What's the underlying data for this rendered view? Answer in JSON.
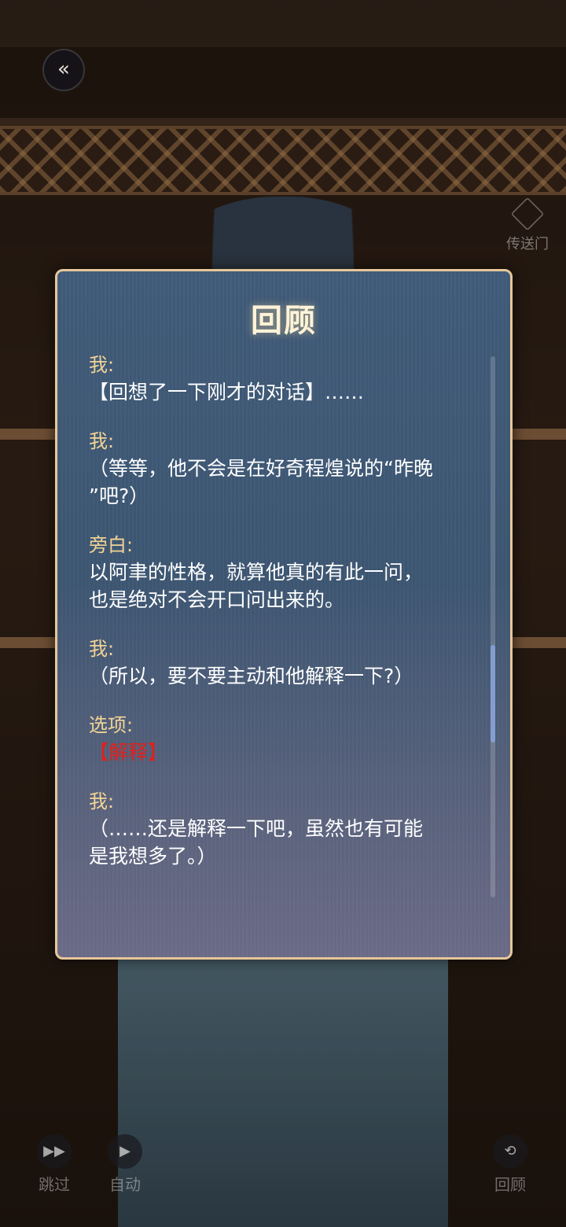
{
  "hud": {
    "teleport_label": "传送门",
    "skip_label": "跳过",
    "auto_label": "自动",
    "review_label": "回顾"
  },
  "review": {
    "title": "回顾",
    "entries": [
      {
        "speaker": "我:",
        "text": "【回想了一下刚才的对话】……"
      },
      {
        "speaker": "我:",
        "text": "（等等，他不会是在好奇程煌说的“昨晚\n”吧?）"
      },
      {
        "speaker": "旁白:",
        "text": "以阿聿的性格，就算他真的有此一问，\n也是绝对不会开口问出来的。"
      },
      {
        "speaker": "我:",
        "text": "（所以，要不要主动和他解释一下?）"
      },
      {
        "speaker": "选项:",
        "choice": "【解释】"
      },
      {
        "speaker": "我:",
        "text": "（……还是解释一下吧，虽然也有可能\n是我想多了。）"
      }
    ],
    "scroll_position": 0.65
  },
  "colors": {
    "panel_border": "#e6c79a",
    "speaker": "#f2d496",
    "choice": "#e0211c"
  }
}
